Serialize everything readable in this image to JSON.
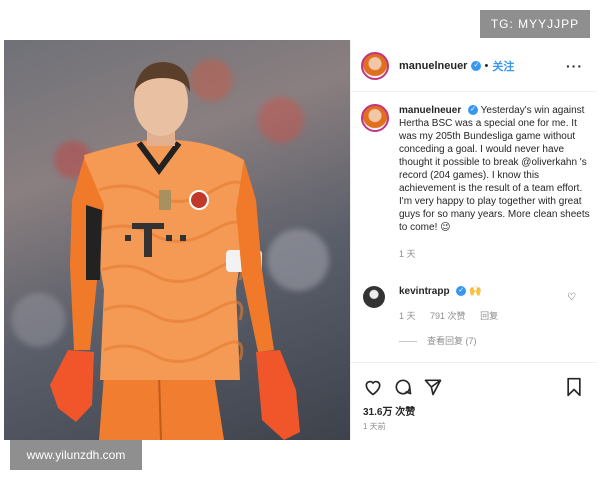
{
  "watermarks": {
    "top_right": "TG: MYYJJPP",
    "bottom_left": "www.yilunzdh.com"
  },
  "photo": {
    "subject": "goalkeeper in orange kit",
    "kit_color": "#f58a3a"
  },
  "post": {
    "username": "manuelneuer",
    "follow_label": "关注",
    "more_icon": "more-dots-icon",
    "caption_text": "Yesterday's win against Hertha BSC was a special one for me. It was my 205th Bundesliga game without conceding a goal. I would never have thought it possible to break @oliverkahn 's record (204 games). I know this achievement is the result of a team effort. I'm very happy to play together with great guys for so many years. More clean sheets to come! 😉",
    "caption_age": "1 天",
    "comment": {
      "username": "kevintrapp",
      "emoji": "🙌",
      "age": "1 天",
      "likes": "791 次赞",
      "reply_label": "回复"
    },
    "view_replies": "查看回复 (7)",
    "likes_count": "31.6万 次赞",
    "posted": "1 天前"
  },
  "colors": {
    "accent": "#3897f0",
    "muted": "#8e8e8e",
    "watermark_bg": "#8f8f8f"
  }
}
